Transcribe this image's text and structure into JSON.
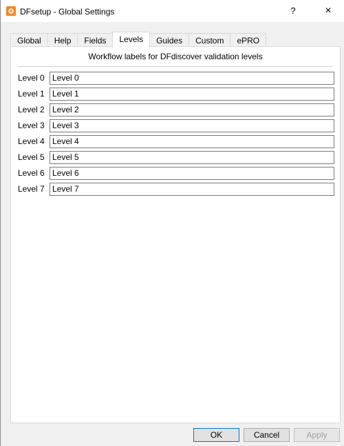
{
  "window": {
    "title": "DFsetup - Global Settings",
    "help_label": "?",
    "close_label": "×"
  },
  "tabs": [
    {
      "label": "Global"
    },
    {
      "label": "Help"
    },
    {
      "label": "Fields"
    },
    {
      "label": "Levels",
      "active": true
    },
    {
      "label": "Guides"
    },
    {
      "label": "Custom"
    },
    {
      "label": "ePRO"
    }
  ],
  "panel": {
    "header": "Workflow labels for DFdiscover validation levels",
    "levels": [
      {
        "label": "Level 0",
        "value": "Level 0"
      },
      {
        "label": "Level 1",
        "value": "Level 1"
      },
      {
        "label": "Level 2",
        "value": "Level 2"
      },
      {
        "label": "Level 3",
        "value": "Level 3"
      },
      {
        "label": "Level 4",
        "value": "Level 4"
      },
      {
        "label": "Level 5",
        "value": "Level 5"
      },
      {
        "label": "Level 6",
        "value": "Level 6"
      },
      {
        "label": "Level 7",
        "value": "Level 7"
      }
    ]
  },
  "buttons": {
    "ok": "OK",
    "cancel": "Cancel",
    "apply": "Apply"
  },
  "colors": {
    "accent": "#0078d7",
    "app_icon": "#f0882a"
  },
  "icons": {
    "app": "app-icon",
    "help": "help-icon",
    "close": "close-icon"
  }
}
